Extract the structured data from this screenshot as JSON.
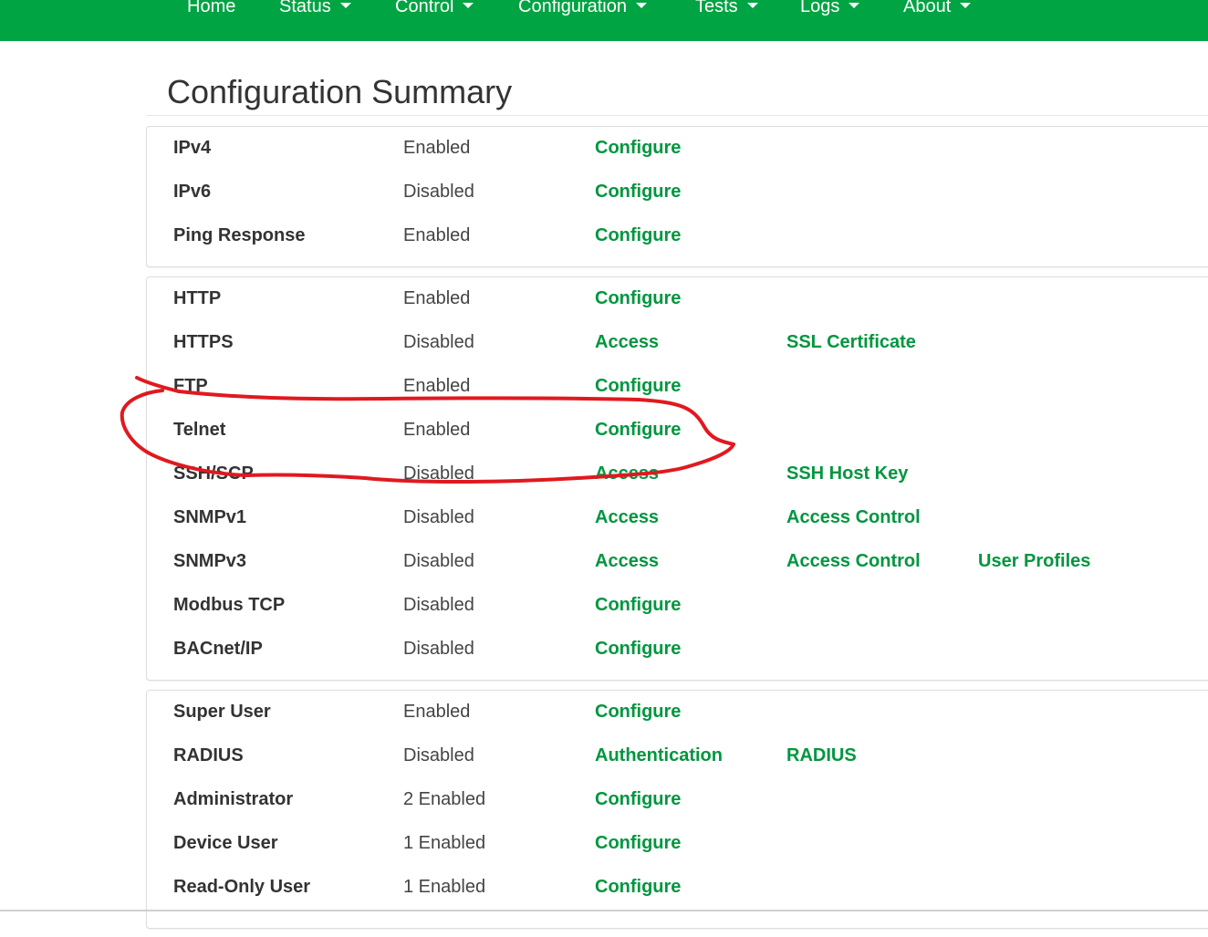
{
  "nav": {
    "items": [
      {
        "label": "Home",
        "dropdown": false
      },
      {
        "label": "Status",
        "dropdown": true
      },
      {
        "label": "Control",
        "dropdown": true
      },
      {
        "label": "Configuration",
        "dropdown": true
      },
      {
        "label": "Tests",
        "dropdown": true
      },
      {
        "label": "Logs",
        "dropdown": true
      },
      {
        "label": "About",
        "dropdown": true
      }
    ]
  },
  "page": {
    "title": "Configuration Summary"
  },
  "groups": [
    {
      "rows": [
        {
          "name": "IPv4",
          "state": "Enabled",
          "actions": [
            "Configure"
          ]
        },
        {
          "name": "IPv6",
          "state": "Disabled",
          "actions": [
            "Configure"
          ]
        },
        {
          "name": "Ping Response",
          "state": "Enabled",
          "actions": [
            "Configure"
          ]
        }
      ]
    },
    {
      "rows": [
        {
          "name": "HTTP",
          "state": "Enabled",
          "actions": [
            "Configure"
          ]
        },
        {
          "name": "HTTPS",
          "state": "Disabled",
          "actions": [
            "Access",
            "SSL Certificate"
          ]
        },
        {
          "name": "FTP",
          "state": "Enabled",
          "actions": [
            "Configure"
          ]
        },
        {
          "name": "Telnet",
          "state": "Enabled",
          "actions": [
            "Configure"
          ]
        },
        {
          "name": "SSH/SCP",
          "state": "Disabled",
          "actions": [
            "Access",
            "SSH Host Key"
          ]
        },
        {
          "name": "SNMPv1",
          "state": "Disabled",
          "actions": [
            "Access",
            "Access Control"
          ]
        },
        {
          "name": "SNMPv3",
          "state": "Disabled",
          "actions": [
            "Access",
            "Access Control",
            "User Profiles"
          ]
        },
        {
          "name": "Modbus TCP",
          "state": "Disabled",
          "actions": [
            "Configure"
          ]
        },
        {
          "name": "BACnet/IP",
          "state": "Disabled",
          "actions": [
            "Configure"
          ]
        }
      ]
    },
    {
      "rows": [
        {
          "name": "Super User",
          "state": "Enabled",
          "actions": [
            "Configure"
          ]
        },
        {
          "name": "RADIUS",
          "state": "Disabled",
          "actions": [
            "Authentication",
            "RADIUS"
          ]
        },
        {
          "name": "Administrator",
          "state": "2 Enabled",
          "actions": [
            "Configure"
          ]
        },
        {
          "name": "Device User",
          "state": "1 Enabled",
          "actions": [
            "Configure"
          ]
        },
        {
          "name": "Read-Only User",
          "state": "1 Enabled",
          "actions": [
            "Configure"
          ]
        }
      ]
    }
  ],
  "colors": {
    "navbar": "#00a443",
    "link": "#00963f",
    "annotation": "#e0191f"
  }
}
